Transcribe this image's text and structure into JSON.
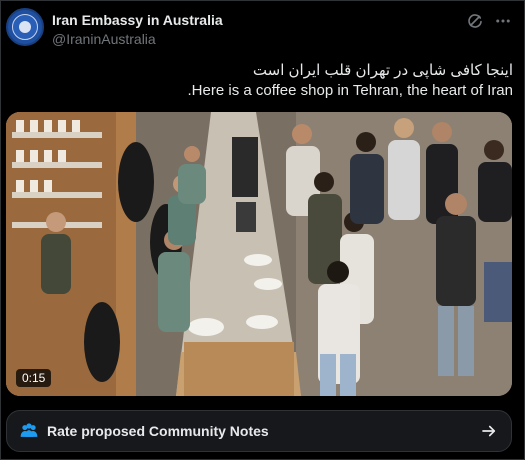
{
  "author": {
    "display_name": "Iran Embassy in Australia",
    "handle": "@IraninAustralia"
  },
  "icons": {
    "avatar": "embassy-emblem-icon",
    "translate": "grok-translate-icon",
    "more": "more-dots-icon",
    "community_notes": "community-notes-icon",
    "arrow": "arrow-right-icon"
  },
  "tweet": {
    "text_fa": "اینجا کافی شاپی در تهران  قلب ایران است",
    "text_en": ".Here is a coffee shop in Tehran, the heart of Iran"
  },
  "media": {
    "duration": "0:15"
  },
  "community_notes": {
    "label": "Rate proposed Community Notes"
  },
  "colors": {
    "background": "#000000",
    "text_primary": "#e7e9ea",
    "text_secondary": "#71767b",
    "border": "#2f3336",
    "accent_blue": "#1d9bf0"
  }
}
